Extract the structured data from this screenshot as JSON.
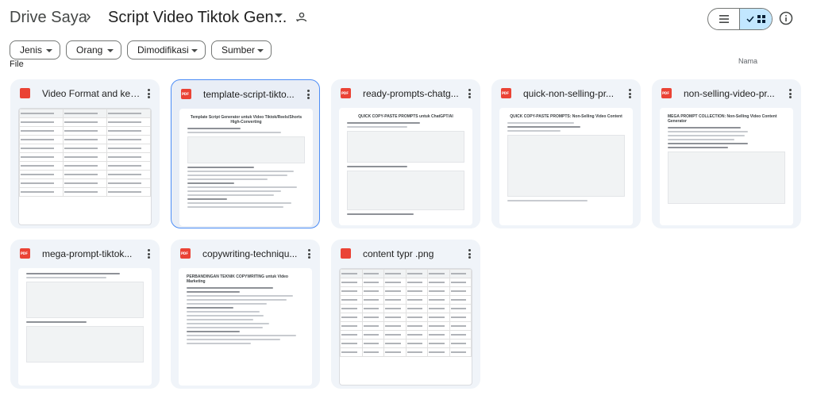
{
  "breadcrumb": {
    "root": "Drive Saya",
    "separator": "›",
    "folder": "Script Video Tiktok Gen..."
  },
  "filters": [
    {
      "label": "Jenis"
    },
    {
      "label": "Orang"
    },
    {
      "label": "Dimodifikasi"
    },
    {
      "label": "Sumber"
    }
  ],
  "section": {
    "label": "File"
  },
  "sort_fragment": "Nama",
  "files": [
    {
      "name": "Video Format and key...",
      "type": "image",
      "thumb": "table"
    },
    {
      "name": "template-script-tikto...",
      "type": "pdf",
      "thumb": "doc",
      "selected": true
    },
    {
      "name": "ready-prompts-chatg...",
      "type": "pdf",
      "thumb": "doc"
    },
    {
      "name": "quick-non-selling-pr...",
      "type": "pdf",
      "thumb": "doc"
    },
    {
      "name": "non-selling-video-pr...",
      "type": "pdf",
      "thumb": "doc"
    },
    {
      "name": "mega-prompt-tiktok...",
      "type": "pdf",
      "thumb": "doc"
    },
    {
      "name": "copywriting-techniqu...",
      "type": "pdf",
      "thumb": "doc"
    },
    {
      "name": "content typr .png",
      "type": "image",
      "thumb": "table"
    }
  ],
  "thumb_headings": {
    "template": "Template Script Generator untuk Video Tiktok/Reels/Shorts High-Converting",
    "ready": "QUICK COPY-PASTE PROMPTS untuk ChatGPT/AI",
    "quick": "QUICK COPY-PASTE PROMPTS: Non-Selling Video Content",
    "nonselling": "MEGA PROMPT COLLECTION: Non-Selling Video Content Generator",
    "copy": "PERBANDINGAN TEKNIK COPYWRITING untuk Video Marketing"
  },
  "colors": {
    "accent": "#c2e7ff",
    "selected_border": "#4c8df6",
    "card_bg": "#f0f4f9",
    "file_icon": "#ea4335"
  },
  "icons": {
    "shared": "shared-folder-icon",
    "list": "list-view-icon",
    "grid": "grid-view-icon",
    "check": "check-icon",
    "info": "info-icon",
    "more": "more-vert-icon"
  }
}
